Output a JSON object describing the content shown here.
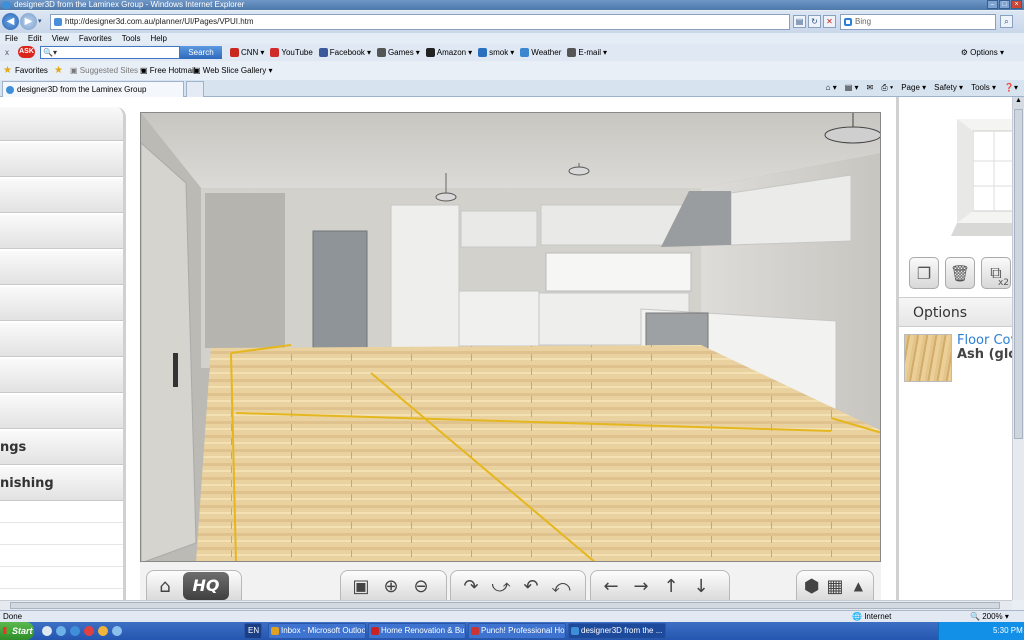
{
  "window": {
    "title": "designer3D from the Laminex Group - Windows Internet Explorer"
  },
  "address": {
    "url": "http://designer3d.com.au/planner/UI/Pages/VPUI.htm"
  },
  "bing": {
    "placeholder": "Bing"
  },
  "menu": [
    "File",
    "Edit",
    "View",
    "Favorites",
    "Tools",
    "Help"
  ],
  "ask": {
    "logo": "ASK",
    "search_button": "Search",
    "links": [
      {
        "label": "CNN",
        "color": "#c8281e"
      },
      {
        "label": "YouTube",
        "color": "#d02b2b"
      },
      {
        "label": "Facebook",
        "color": "#3b5998"
      },
      {
        "label": "Games",
        "color": "#555555"
      },
      {
        "label": "Amazon",
        "color": "#222222"
      },
      {
        "label": "smok",
        "color": "#2b6fbf"
      },
      {
        "label": "Weather",
        "color": "#3c86cf"
      },
      {
        "label": "E-mail",
        "color": "#555555"
      }
    ],
    "options": "Options"
  },
  "favorites": {
    "label": "Favorites",
    "items": [
      "Suggested Sites",
      "Free Hotmail",
      "Web Slice Gallery"
    ]
  },
  "tab": {
    "title": "designer3D from the Laminex Group"
  },
  "commandbar": [
    "Page",
    "Safety",
    "Tools"
  ],
  "left_panel": {
    "rows": [
      "",
      "",
      "",
      "",
      "",
      "",
      "",
      "",
      "",
      "",
      "ngs",
      "nishing"
    ]
  },
  "right_panel": {
    "options_label": "Options",
    "floor_title": "Floor Cove",
    "floor_material": "Ash  (glos",
    "x2": "x2"
  },
  "toolbar": {
    "hq_label": "HQ"
  },
  "status": {
    "left": "Done",
    "zone": "Internet",
    "zoom": "200%"
  },
  "taskbar": {
    "start": "Start",
    "tasks": [
      {
        "label": "EN",
        "color": "#1b3f87"
      },
      {
        "label": "Inbox - Microsoft Outlook",
        "color": "#e0a020"
      },
      {
        "label": "Home Renovation & Build...",
        "color": "#cc2222"
      },
      {
        "label": "Punch! Professional Hom...",
        "color": "#cc3333"
      },
      {
        "label": "designer3D from the ...",
        "color": "#3f8fd8"
      }
    ],
    "clock": "5:30 PM"
  }
}
